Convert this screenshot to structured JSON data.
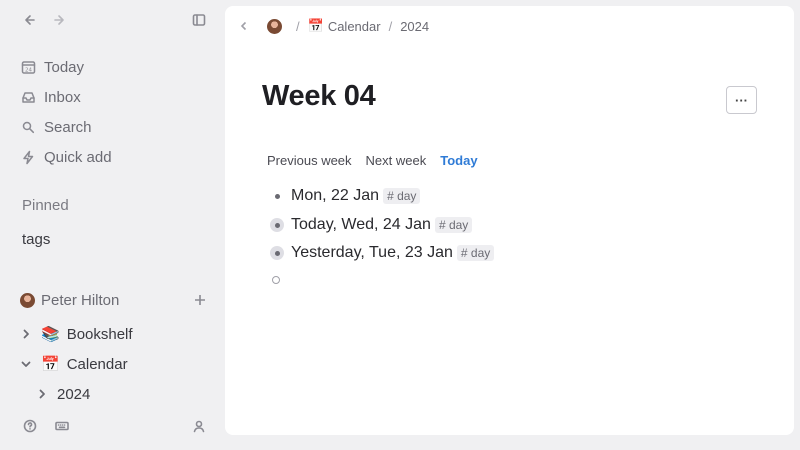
{
  "sidebar": {
    "nav": [
      {
        "label": "Today",
        "icon": "calendar-date-icon"
      },
      {
        "label": "Inbox",
        "icon": "inbox-icon"
      },
      {
        "label": "Search",
        "icon": "search-icon"
      },
      {
        "label": "Quick add",
        "icon": "lightning-icon"
      }
    ],
    "pinned_label": "Pinned",
    "tags_label": "tags",
    "user_name": "Peter Hilton",
    "tree": [
      {
        "label": "Bookshelf",
        "emoji": "📚",
        "expanded": false
      },
      {
        "label": "Calendar",
        "emoji": "📅",
        "expanded": true
      },
      {
        "label": "2024",
        "emoji": "",
        "expanded": false
      }
    ]
  },
  "breadcrumb": {
    "items": [
      {
        "label": "Calendar",
        "emoji": "📅"
      },
      {
        "label": "2024"
      }
    ],
    "separator": "/"
  },
  "page": {
    "title": "Week 04",
    "more_label": "···",
    "week_nav": {
      "previous": "Previous week",
      "next": "Next week",
      "today": "Today"
    },
    "bullets": [
      {
        "text": "Mon, 22 Jan",
        "tag": "# day",
        "style": "plain"
      },
      {
        "text": "Today, Wed, 24 Jan",
        "tag": "# day",
        "style": "ring"
      },
      {
        "text": "Yesterday, Tue, 23 Jan",
        "tag": "# day",
        "style": "ring"
      }
    ]
  },
  "colors": {
    "accent": "#2f7bd6",
    "sidebar_bg": "#f0f0f2",
    "panel_bg": "#ffffff"
  }
}
